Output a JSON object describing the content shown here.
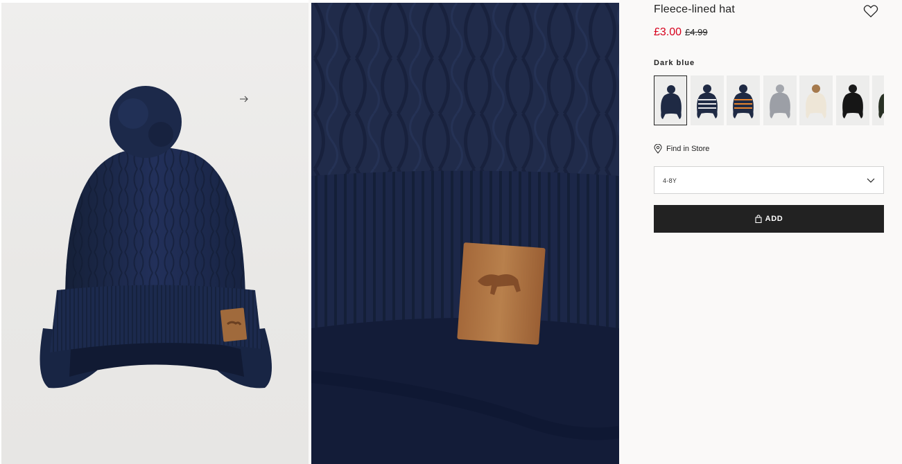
{
  "product": {
    "title": "Fleece-lined hat",
    "price_sale": "£3.00",
    "price_original": "£4.99",
    "color_name": "Dark blue",
    "colors": {
      "sale": "#d6001c",
      "primary_button": "#222222"
    }
  },
  "gallery": {
    "images": [
      {
        "name": "product-image-front",
        "subject": "navy cable-knit hat with pompom"
      },
      {
        "name": "product-image-detail",
        "subject": "close-up of leather bear label"
      }
    ]
  },
  "swatches": [
    {
      "name": "dark-blue",
      "hat": "#1f2a44",
      "pom": "#1f2a44",
      "stripe": "",
      "selected": true
    },
    {
      "name": "stars",
      "hat": "#1f2a44",
      "pom": "#1f2a44",
      "stripe": "#e8e8ea",
      "selected": false
    },
    {
      "name": "stripes",
      "hat": "#1f2a44",
      "pom": "#1f2a44",
      "stripe": "#e7832e",
      "selected": false
    },
    {
      "name": "grey",
      "hat": "#9c9fa6",
      "pom": "#a4a7ad",
      "stripe": "",
      "selected": false
    },
    {
      "name": "cream",
      "hat": "#eee6d7",
      "pom": "#a67a4d",
      "stripe": "",
      "selected": false
    },
    {
      "name": "black",
      "hat": "#161616",
      "pom": "#1a1a1a",
      "stripe": "",
      "selected": false
    },
    {
      "name": "dark-green",
      "hat": "#2a3226",
      "pom": "#2a3226",
      "stripe": "",
      "selected": false
    }
  ],
  "store": {
    "find_in_store_label": "Find in Store",
    "icon": "location-pin-icon"
  },
  "size_select": {
    "selected_value": "4-8Y",
    "icon": "chevron-down-icon"
  },
  "add_button": {
    "label": "ADD",
    "icon": "shopping-bag-icon"
  },
  "icons": {
    "favorite": "heart-icon",
    "next": "arrow-right-icon"
  }
}
